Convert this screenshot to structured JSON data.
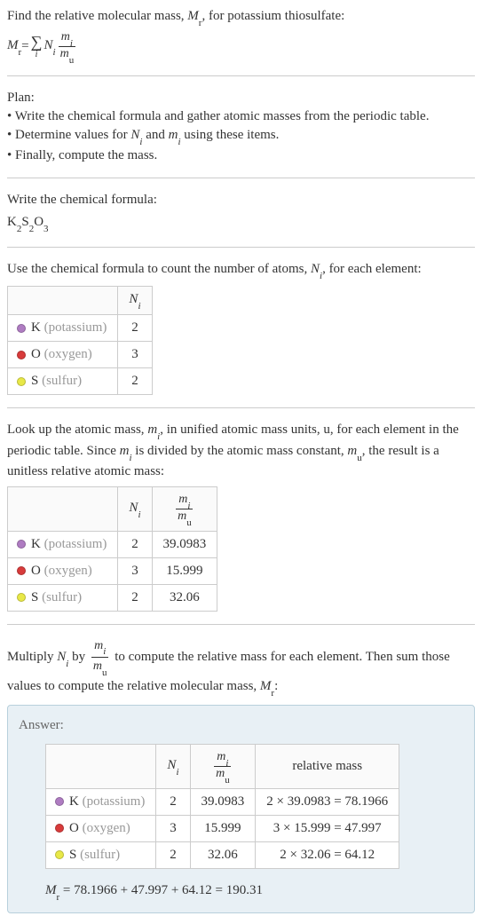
{
  "intro": {
    "line1_prefix": "Find the relative molecular mass, ",
    "line1_var": "M",
    "line1_sub": "r",
    "line1_suffix": ", for potassium thiosulfate:",
    "eq_lhs_var": "M",
    "eq_lhs_sub": "r",
    "eq_eq": " = ",
    "eq_N": "N",
    "eq_i": "i",
    "eq_m": "m",
    "eq_mu_m": "m",
    "eq_mu_u": "u"
  },
  "plan": {
    "title": "Plan:",
    "b1_prefix": "• Write the chemical formula and gather atomic masses from the periodic table.",
    "b2_prefix": "• Determine values for ",
    "b2_mid": " and ",
    "b2_suffix": " using these items.",
    "b3": "• Finally, compute the mass."
  },
  "write": {
    "title": "Write the chemical formula:",
    "k": "K",
    "k2": "2",
    "s": "S",
    "s2": "2",
    "o": "O",
    "o3": "3"
  },
  "count": {
    "text_prefix": "Use the chemical formula to count the number of atoms, ",
    "text_suffix": ", for each element:",
    "header_N": "N",
    "header_i": "i",
    "rows": [
      {
        "sym": "K",
        "name": " (potassium)",
        "n": "2"
      },
      {
        "sym": "O",
        "name": " (oxygen)",
        "n": "3"
      },
      {
        "sym": "S",
        "name": " (sulfur)",
        "n": "2"
      }
    ]
  },
  "lookup": {
    "text_prefix": "Look up the atomic mass, ",
    "text_mid1": ", in unified atomic mass units, u, for each element in the periodic table. Since ",
    "text_mid2": " is divided by the atomic mass constant, ",
    "text_suffix": ", the result is a unitless relative atomic mass:",
    "rows": [
      {
        "sym": "K",
        "name": " (potassium)",
        "n": "2",
        "mass": "39.0983"
      },
      {
        "sym": "O",
        "name": " (oxygen)",
        "n": "3",
        "mass": "15.999"
      },
      {
        "sym": "S",
        "name": " (sulfur)",
        "n": "2",
        "mass": "32.06"
      }
    ]
  },
  "multiply": {
    "text_prefix": "Multiply ",
    "text_mid1": " by ",
    "text_mid2": " to compute the relative mass for each element. Then sum those values to compute the relative molecular mass, ",
    "text_suffix": ":"
  },
  "answer": {
    "label": "Answer:",
    "header_rel": "relative mass",
    "rows": [
      {
        "sym": "K",
        "name": " (potassium)",
        "n": "2",
        "mass": "39.0983",
        "calc": "2 × 39.0983 = 78.1966"
      },
      {
        "sym": "O",
        "name": " (oxygen)",
        "n": "3",
        "mass": "15.999",
        "calc": "3 × 15.999 = 47.997"
      },
      {
        "sym": "S",
        "name": " (sulfur)",
        "n": "2",
        "mass": "32.06",
        "calc": "2 × 32.06 = 64.12"
      }
    ],
    "final_eq": " = 78.1966 + 47.997 + 64.12 = 190.31"
  },
  "chart_data": {
    "type": "table",
    "title": "Relative molecular mass of potassium thiosulfate K2S2O3",
    "elements": [
      {
        "element": "K (potassium)",
        "N_i": 2,
        "m_i_over_m_u": 39.0983,
        "relative_mass": 78.1966
      },
      {
        "element": "O (oxygen)",
        "N_i": 3,
        "m_i_over_m_u": 15.999,
        "relative_mass": 47.997
      },
      {
        "element": "S (sulfur)",
        "N_i": 2,
        "m_i_over_m_u": 32.06,
        "relative_mass": 64.12
      }
    ],
    "M_r": 190.31
  }
}
